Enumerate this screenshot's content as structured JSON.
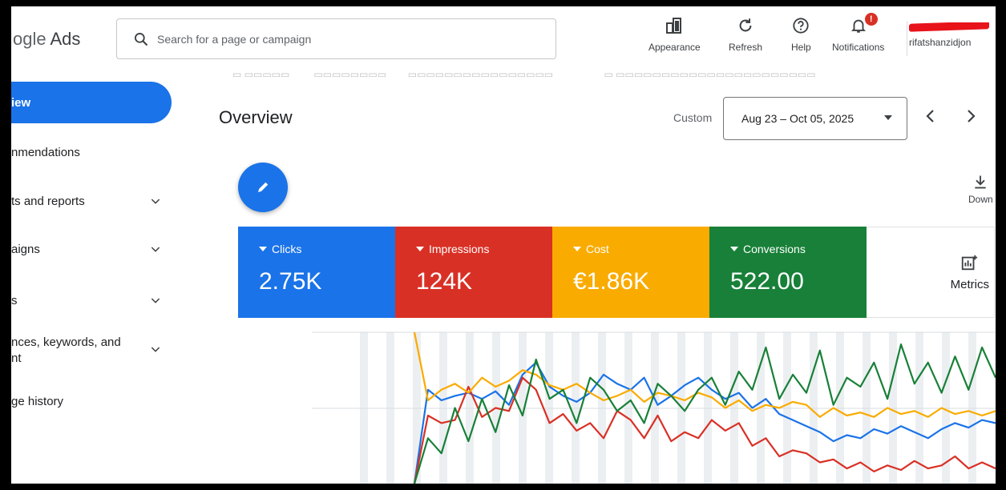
{
  "app": {
    "brand_prefix": "ogle",
    "brand_suffix": "Ads"
  },
  "search": {
    "placeholder": "Search for a page or campaign"
  },
  "toolbar": {
    "appearance": "Appearance",
    "refresh": "Refresh",
    "help": "Help",
    "notifications": "Notifications",
    "notification_badge": "!"
  },
  "account": {
    "username": "rifatshanzidjon"
  },
  "sidebar": {
    "items": [
      {
        "label": "iew"
      },
      {
        "label": "nmendations"
      },
      {
        "label": "ts and reports"
      },
      {
        "label": "aigns"
      },
      {
        "label": "s"
      },
      {
        "label": "nces, keywords, and",
        "label2": "nt"
      },
      {
        "label": "ge history"
      }
    ]
  },
  "overview": {
    "title": "Overview",
    "range_label": "Custom",
    "date_range": "Aug 23 – Oct 05, 2025",
    "download_label": "Down"
  },
  "metrics": [
    {
      "label": "Clicks",
      "value": "2.75K",
      "color": "#1a73e8"
    },
    {
      "label": "Impressions",
      "value": "124K",
      "color": "#d93025"
    },
    {
      "label": "Cost",
      "value": "€1.86K",
      "color": "#f9ab00"
    },
    {
      "label": "Conversions",
      "value": "522.00",
      "color": "#188038"
    }
  ],
  "metrics_button": {
    "label": "Metrics"
  },
  "chart_data": {
    "type": "line",
    "grid": true,
    "series": [
      {
        "color": "#1a73e8",
        "values": [
          0.0,
          0.62,
          0.55,
          0.58,
          0.6,
          0.56,
          0.61,
          0.52,
          0.72,
          0.8,
          0.64,
          0.58,
          0.54,
          0.6,
          0.72,
          0.66,
          0.62,
          0.7,
          0.52,
          0.58,
          0.65,
          0.7,
          0.62,
          0.56,
          0.6,
          0.5,
          0.56,
          0.46,
          0.42,
          0.38,
          0.34,
          0.28,
          0.32,
          0.3,
          0.36,
          0.33,
          0.38,
          0.34,
          0.3,
          0.36,
          0.4,
          0.37,
          0.42,
          0.4
        ]
      },
      {
        "color": "#d93025",
        "values": [
          0.0,
          0.45,
          0.4,
          0.42,
          0.64,
          0.44,
          0.5,
          0.48,
          0.7,
          0.62,
          0.4,
          0.46,
          0.35,
          0.4,
          0.3,
          0.48,
          0.42,
          0.3,
          0.45,
          0.28,
          0.34,
          0.3,
          0.42,
          0.35,
          0.4,
          0.25,
          0.3,
          0.18,
          0.22,
          0.2,
          0.14,
          0.16,
          0.1,
          0.14,
          0.08,
          0.12,
          0.09,
          0.15,
          0.1,
          0.12,
          0.18,
          0.1,
          0.14,
          0.1
        ]
      },
      {
        "color": "#f9ab00",
        "values": [
          1.0,
          0.55,
          0.62,
          0.66,
          0.6,
          0.7,
          0.64,
          0.68,
          0.75,
          0.72,
          0.65,
          0.62,
          0.66,
          0.6,
          0.55,
          0.58,
          0.62,
          0.54,
          0.6,
          0.58,
          0.55,
          0.6,
          0.57,
          0.5,
          0.55,
          0.48,
          0.52,
          0.5,
          0.54,
          0.52,
          0.44,
          0.5,
          0.45,
          0.47,
          0.44,
          0.5,
          0.46,
          0.48,
          0.44,
          0.5,
          0.46,
          0.48,
          0.45,
          0.48
        ]
      },
      {
        "color": "#188038",
        "values": [
          0.0,
          0.3,
          0.2,
          0.5,
          0.28,
          0.56,
          0.34,
          0.65,
          0.45,
          0.82,
          0.56,
          0.62,
          0.4,
          0.7,
          0.62,
          0.48,
          0.55,
          0.4,
          0.66,
          0.58,
          0.48,
          0.62,
          0.7,
          0.52,
          0.74,
          0.62,
          0.9,
          0.56,
          0.72,
          0.6,
          0.88,
          0.52,
          0.7,
          0.64,
          0.8,
          0.56,
          0.92,
          0.66,
          0.8,
          0.6,
          0.84,
          0.62,
          0.9,
          0.7
        ]
      }
    ]
  }
}
